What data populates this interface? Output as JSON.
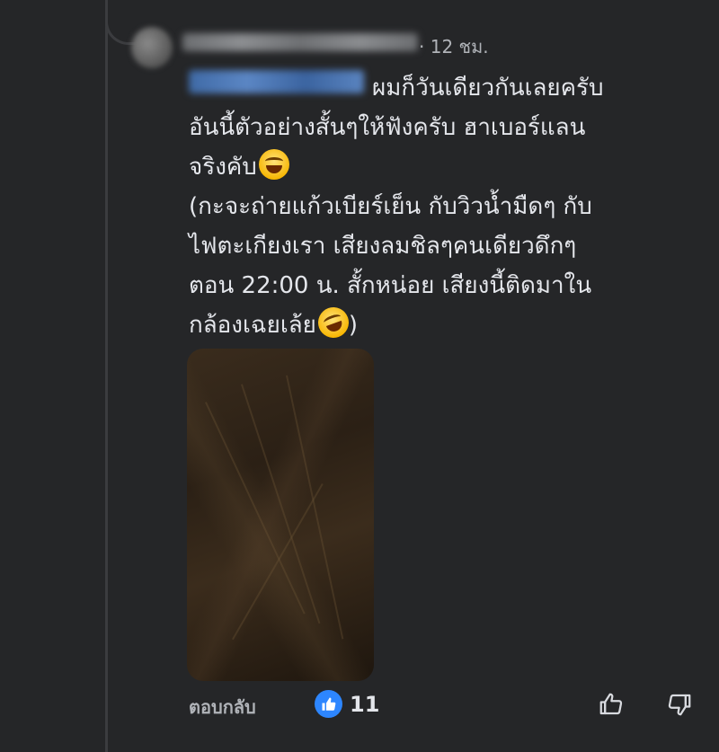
{
  "comment": {
    "author": "",
    "timestamp": "· 12 ชม.",
    "mention": "",
    "lines": [
      "ผมก็วันเดียวกันเลยครับ",
      "อันนี้ตัวอย่างสั้นๆให้ฟังครับ ฮาเบอร์แลน",
      "จริงคับ",
      "(กะจะถ่ายแก้วเบียร์เย็น กับวิวน้ำมืดๆ กับ",
      "ไฟตะเกียงเรา เสียงลมชิลๆคนเดียวดึกๆ",
      "ตอน 22:00 น. สั้กหน่อย เสียงนี้ติดมาใน",
      "กล้องเฉยเล้ย",
      ")"
    ],
    "emojis": [
      "tears-of-joy-emoji",
      "rolling-laughing-emoji"
    ]
  },
  "actions": {
    "reply_label": "ตอบกลับ",
    "reaction_count": "11",
    "reaction_icon": "like-icon",
    "upvote_icon": "thumbs-up-icon",
    "downvote_icon": "thumbs-down-icon"
  },
  "colors": {
    "background": "#252628",
    "like_blue": "#2d86ff",
    "muted_text": "#b0b3b8"
  }
}
